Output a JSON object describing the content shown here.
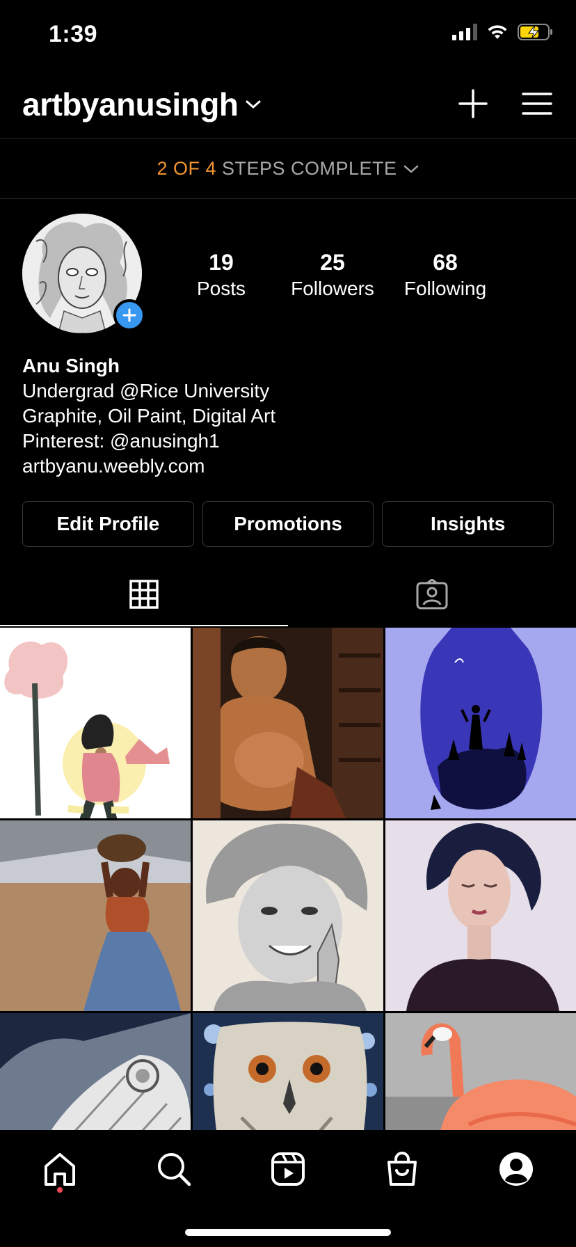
{
  "status_bar": {
    "time": "1:39"
  },
  "header": {
    "username": "artbyanusingh"
  },
  "steps_banner": {
    "progress": "2 OF 4",
    "label": "STEPS COMPLETE"
  },
  "stats": [
    {
      "value": "19",
      "label": "Posts"
    },
    {
      "value": "25",
      "label": "Followers"
    },
    {
      "value": "68",
      "label": "Following"
    }
  ],
  "bio": {
    "name": "Anu Singh",
    "lines": [
      "Undergrad @Rice University",
      "Graphite, Oil Paint, Digital Art",
      "Pinterest: @anusingh1"
    ],
    "link": "artbyanu.weebly.com"
  },
  "buttons": {
    "edit": "Edit Profile",
    "promotions": "Promotions",
    "insights": "Insights"
  },
  "tabs": [
    {
      "icon": "grid-icon",
      "active": true
    },
    {
      "icon": "tagged-icon",
      "active": false
    }
  ],
  "bottom_nav": [
    "home-icon",
    "search-icon",
    "reels-icon",
    "shop-icon",
    "profile-icon"
  ],
  "colors": {
    "accent": "#3897f0",
    "progress": "#f09433",
    "notification": "#ed4956"
  }
}
